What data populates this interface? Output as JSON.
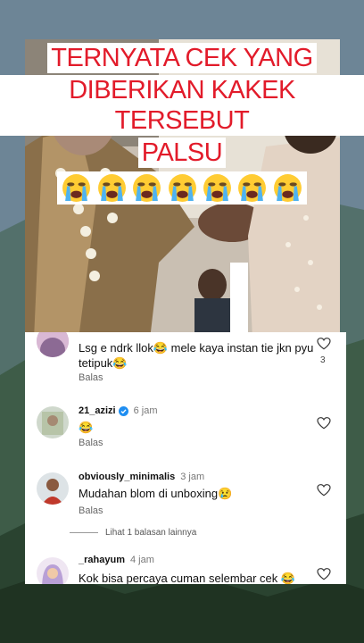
{
  "video": {
    "caption_lines": [
      "TERNYATA CEK YANG",
      "DIBERIKAN KAKEK TERSEBUT",
      "PALSU"
    ],
    "emoji_name": "loudly-crying-face-icon",
    "emoji_count": 7
  },
  "comments": [
    {
      "username": "",
      "time": "",
      "text": "Lsg e ndrk llok😂 mele kaya instan tie jkn pyu tetipuk😂",
      "reply_label": "Balas",
      "likes": "3"
    },
    {
      "username": "21_azizi",
      "verified": true,
      "time": "6 jam",
      "text": "😂",
      "reply_label": "Balas",
      "likes": ""
    },
    {
      "username": "obviously_minimalis",
      "time": "3 jam",
      "text": "Mudahan blom di unboxing😢",
      "reply_label": "Balas",
      "likes": ""
    },
    {
      "username": "_rahayum",
      "time": "4 jam",
      "text": "Kok bisa percaya cuman selembar cek 😂",
      "reply_label": "",
      "likes": ""
    }
  ],
  "more_replies": "Lihat 1 balasan lainnya",
  "colors": {
    "caption_text": "#e21b2a",
    "caption_bg": "#ffffff",
    "verified": "#1f8ef1"
  }
}
